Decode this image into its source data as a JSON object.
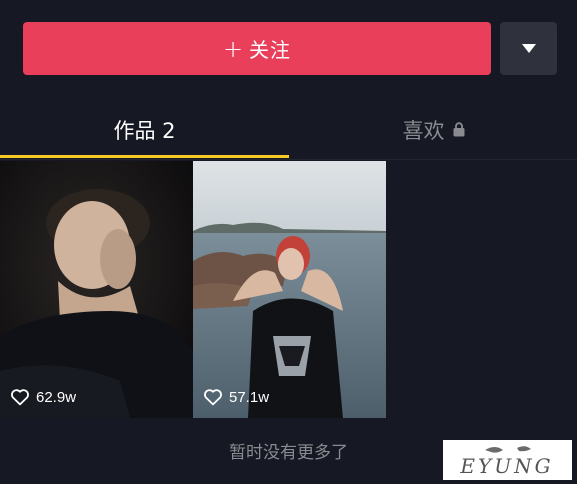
{
  "colors": {
    "background": "#161823",
    "accent": "#ea3f5b",
    "tab_indicator": "#f8c824",
    "muted_text": "#8a8b91"
  },
  "actions": {
    "follow_icon": "plus-icon",
    "follow_label": "关注",
    "more_icon": "triangle-down-icon"
  },
  "tabs": [
    {
      "label": "作品 2",
      "active": true
    },
    {
      "label": "喜欢",
      "active": false,
      "icon": "lock-icon"
    }
  ],
  "videos": [
    {
      "likes": "62.9w",
      "icon": "heart-outline-icon"
    },
    {
      "likes": "57.1w",
      "icon": "heart-outline-icon"
    }
  ],
  "footer": {
    "no_more_text": "暂时没有更多了"
  },
  "watermark": {
    "text": "EYUNG"
  }
}
